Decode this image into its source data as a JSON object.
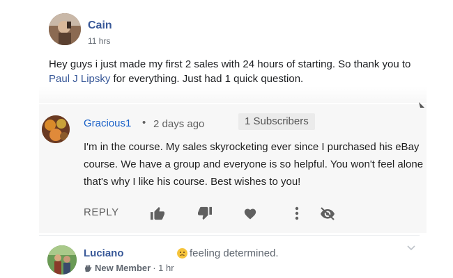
{
  "post1": {
    "author": "Cain",
    "time": "11 hrs",
    "text_before": "Hey guys i just made my first 2 sales with 24 hours of starting. So thank you to ",
    "mention": "Paul J Lipsky",
    "text_after": " for everything. Just had 1 quick question."
  },
  "comment": {
    "author": "Gracious1",
    "separator": "•",
    "age": "2 days ago",
    "subscribers": "1 Subscribers",
    "text": "I'm in the course. My sales skyrocketing ever since I purchased his eBay course. We have a group and everyone is so helpful. You won't feel alone that's why I like his course. Best wishes to you!",
    "reply_label": "REPLY",
    "icons": [
      "thumbs-up-icon",
      "thumbs-down-icon",
      "heart-icon",
      "more-vert-icon",
      "hide-icon"
    ]
  },
  "post2": {
    "author": "Luciano",
    "feeling": "feeling determined.",
    "badge": "New Member",
    "time": "· 1 hr"
  },
  "colors": {
    "fb_link": "#385898",
    "yt_link": "#1a61c8",
    "muted": "#606060"
  }
}
